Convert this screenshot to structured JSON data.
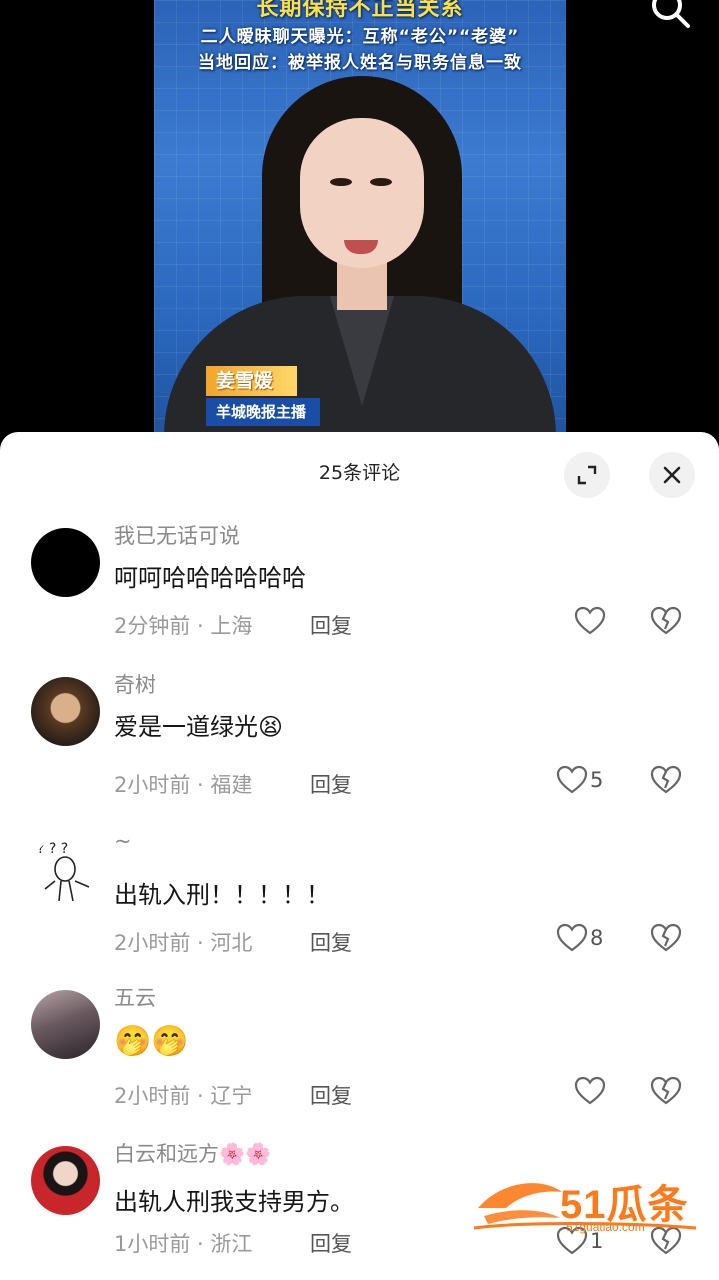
{
  "video": {
    "headline_1": "长期保持不正当关系",
    "headline_2": "二人暧昧聊天曝光：互称“老公”“老婆”",
    "headline_3": "当地回应：被举报人姓名与职务信息一致",
    "anchor_name": "姜雪媛",
    "anchor_title": "羊城晚报主播",
    "search_icon": "search-icon"
  },
  "sheet": {
    "title": "25条评论",
    "expand_icon": "expand-icon",
    "close_icon": "close-icon"
  },
  "comments": [
    {
      "username": "我已无话可说",
      "content": "呵呵哈哈哈哈哈哈",
      "time": "2分钟前",
      "location": "上海",
      "reply": "回复",
      "likes": ""
    },
    {
      "username": "奇树",
      "content": "爱是一道绿光",
      "emoji": "😫",
      "time": "2小时前",
      "location": "福建",
      "reply": "回复",
      "likes": "5"
    },
    {
      "username": "~",
      "content": "出轨入刑！！！！！",
      "time": "2小时前",
      "location": "河北",
      "reply": "回复",
      "likes": "8"
    },
    {
      "username": "五云",
      "content": "🤭🤭",
      "time": "2小时前",
      "location": "辽宁",
      "reply": "回复",
      "likes": ""
    },
    {
      "username": "白云和远方🌸🌸",
      "content": "出轨人刑我支持男方。",
      "time": "1小时前",
      "location": "浙江",
      "reply": "回复",
      "likes": "1"
    }
  ],
  "meta_separator": " · ",
  "watermark": {
    "text": "51瓜条",
    "url": "51guatiao.com"
  },
  "colors": {
    "accent": "#ff7a1a",
    "sheet_bg": "#ffffff",
    "video_bg": "#2b63b8"
  }
}
